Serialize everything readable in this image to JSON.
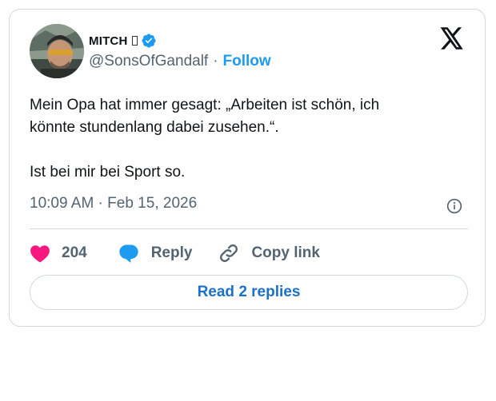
{
  "author": {
    "display_name": "MITCH",
    "handle": "@SonsOfGandalf",
    "follow_label": "Follow",
    "verified_color": "#1d9bf0",
    "avatar_icon": "avatar-photo"
  },
  "tweet": {
    "lines": [
      "Mein Opa hat immer gesagt: „Arbeiten ist schön, ich",
      "könnte stundenlang dabei zusehen.“."
    ],
    "paragraph2": "Ist bei mir bei Sport so.",
    "timestamp": "10:09 AM · Feb 15, 2026"
  },
  "actions": {
    "like_count": "204",
    "reply_label": "Reply",
    "copy_label": "Copy link",
    "like_color": "#f91880"
  },
  "footer": {
    "read_replies_label": "Read 2 replies"
  }
}
